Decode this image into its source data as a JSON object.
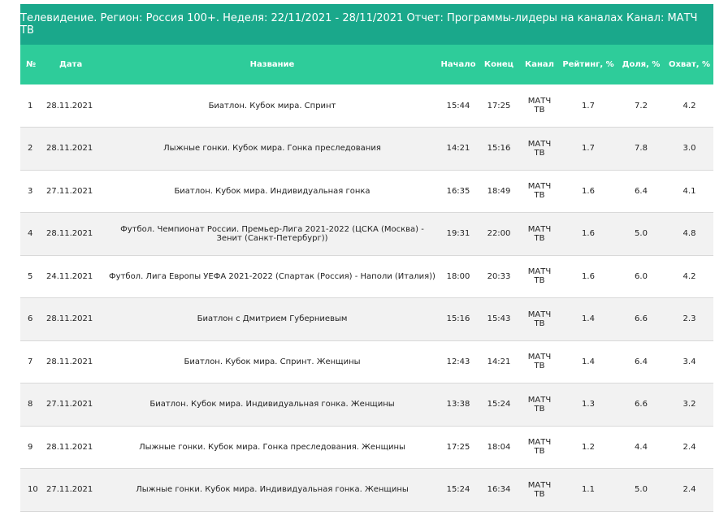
{
  "report": {
    "title": "Телевидение. Регион: Россия 100+. Неделя: 22/11/2021 - 28/11/2021 Отчет: Программы-лидеры на каналах Канал: МАТЧ ТВ"
  },
  "table": {
    "headers": {
      "num": "№",
      "date": "Дата",
      "name": "Название",
      "start": "Начало",
      "end": "Конец",
      "channel": "Канал",
      "rating": "Рейтинг, %",
      "share": "Доля, %",
      "reach": "Охват, %"
    },
    "rows": [
      {
        "num": "1",
        "date": "28.11.2021",
        "name": "Биатлон. Кубок мира. Спринт",
        "start": "15:44",
        "end": "17:25",
        "channel": "МАТЧ ТВ",
        "rating": "1.7",
        "share": "7.2",
        "reach": "4.2"
      },
      {
        "num": "2",
        "date": "28.11.2021",
        "name": "Лыжные гонки. Кубок мира. Гонка преследования",
        "start": "14:21",
        "end": "15:16",
        "channel": "МАТЧ ТВ",
        "rating": "1.7",
        "share": "7.8",
        "reach": "3.0"
      },
      {
        "num": "3",
        "date": "27.11.2021",
        "name": "Биатлон. Кубок мира. Индивидуальная гонка",
        "start": "16:35",
        "end": "18:49",
        "channel": "МАТЧ ТВ",
        "rating": "1.6",
        "share": "6.4",
        "reach": "4.1"
      },
      {
        "num": "4",
        "date": "28.11.2021",
        "name": "Футбол. Чемпионат России. Премьер-Лига 2021-2022 (ЦСКА (Москва) - Зенит (Санкт-Петербург))",
        "start": "19:31",
        "end": "22:00",
        "channel": "МАТЧ ТВ",
        "rating": "1.6",
        "share": "5.0",
        "reach": "4.8"
      },
      {
        "num": "5",
        "date": "24.11.2021",
        "name": "Футбол. Лига Европы УЕФА 2021-2022 (Спартак (Россия) - Наполи (Италия))",
        "start": "18:00",
        "end": "20:33",
        "channel": "МАТЧ ТВ",
        "rating": "1.6",
        "share": "6.0",
        "reach": "4.2"
      },
      {
        "num": "6",
        "date": "28.11.2021",
        "name": "Биатлон с Дмитрием Губерниевым",
        "start": "15:16",
        "end": "15:43",
        "channel": "МАТЧ ТВ",
        "rating": "1.4",
        "share": "6.6",
        "reach": "2.3"
      },
      {
        "num": "7",
        "date": "28.11.2021",
        "name": "Биатлон. Кубок мира. Спринт. Женщины",
        "start": "12:43",
        "end": "14:21",
        "channel": "МАТЧ ТВ",
        "rating": "1.4",
        "share": "6.4",
        "reach": "3.4"
      },
      {
        "num": "8",
        "date": "27.11.2021",
        "name": "Биатлон. Кубок мира. Индивидуальная гонка. Женщины",
        "start": "13:38",
        "end": "15:24",
        "channel": "МАТЧ ТВ",
        "rating": "1.3",
        "share": "6.6",
        "reach": "3.2"
      },
      {
        "num": "9",
        "date": "28.11.2021",
        "name": "Лыжные гонки. Кубок мира. Гонка преследования. Женщины",
        "start": "17:25",
        "end": "18:04",
        "channel": "МАТЧ ТВ",
        "rating": "1.2",
        "share": "4.4",
        "reach": "2.4"
      },
      {
        "num": "10",
        "date": "27.11.2021",
        "name": "Лыжные гонки. Кубок мира. Индивидуальная гонка. Женщины",
        "start": "15:24",
        "end": "16:34",
        "channel": "МАТЧ ТВ",
        "rating": "1.1",
        "share": "5.0",
        "reach": "2.4"
      }
    ]
  },
  "colors": {
    "title_bg": "#1aa88b",
    "header_bg": "#2ecc9a",
    "row_alt_bg": "#f2f2f2"
  }
}
